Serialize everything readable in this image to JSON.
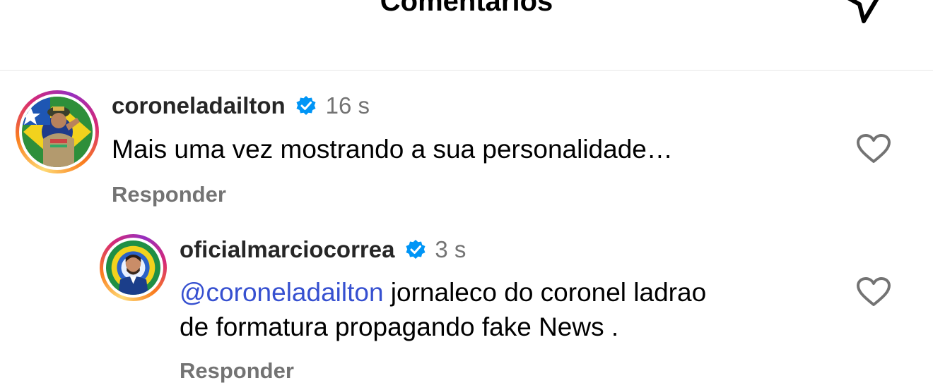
{
  "header": {
    "title": "Comentários"
  },
  "comments": [
    {
      "username": "coroneladailton",
      "time": "16 s",
      "text": "Mais uma vez mostrando a sua personalidade…",
      "reply_label": "Responder"
    },
    {
      "username": "oficialmarciocorrea",
      "time": "3 s",
      "mention": "@coroneladailton",
      "text_line1": " jornaleco do coronel ladrao",
      "text_line2": "de formatura propagando fake News .",
      "reply_label": "Responder"
    }
  ],
  "colors": {
    "verified": "#0095f6",
    "mention": "#3650d0",
    "secondary_text": "#737373"
  },
  "icons": [
    "share-icon",
    "verified-badge-icon",
    "heart-icon"
  ]
}
